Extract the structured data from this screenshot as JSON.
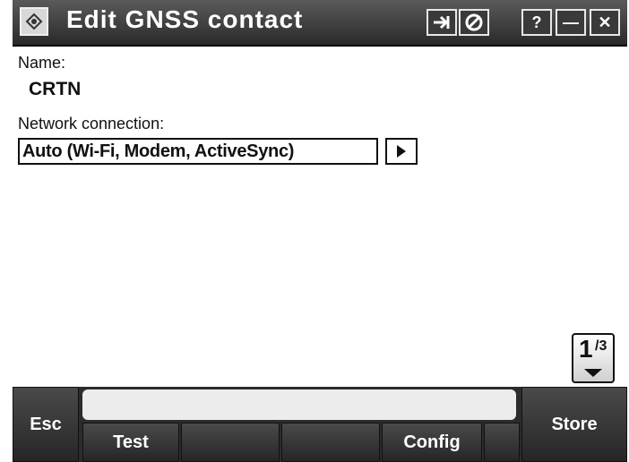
{
  "window": {
    "title": "Edit GNSS contact"
  },
  "titlebar_buttons": {
    "help_label": "?",
    "minimize_label": "—",
    "close_label": "✕"
  },
  "form": {
    "name_label": "Name:",
    "name_value": "CRTN",
    "network_label": "Network connection:",
    "network_value": "Auto (Wi-Fi, Modem, ActiveSync)"
  },
  "page_indicator": {
    "current": "1",
    "total": "/3"
  },
  "softkeys": {
    "esc": "Esc",
    "test": "Test",
    "config": "Config",
    "store": "Store"
  }
}
